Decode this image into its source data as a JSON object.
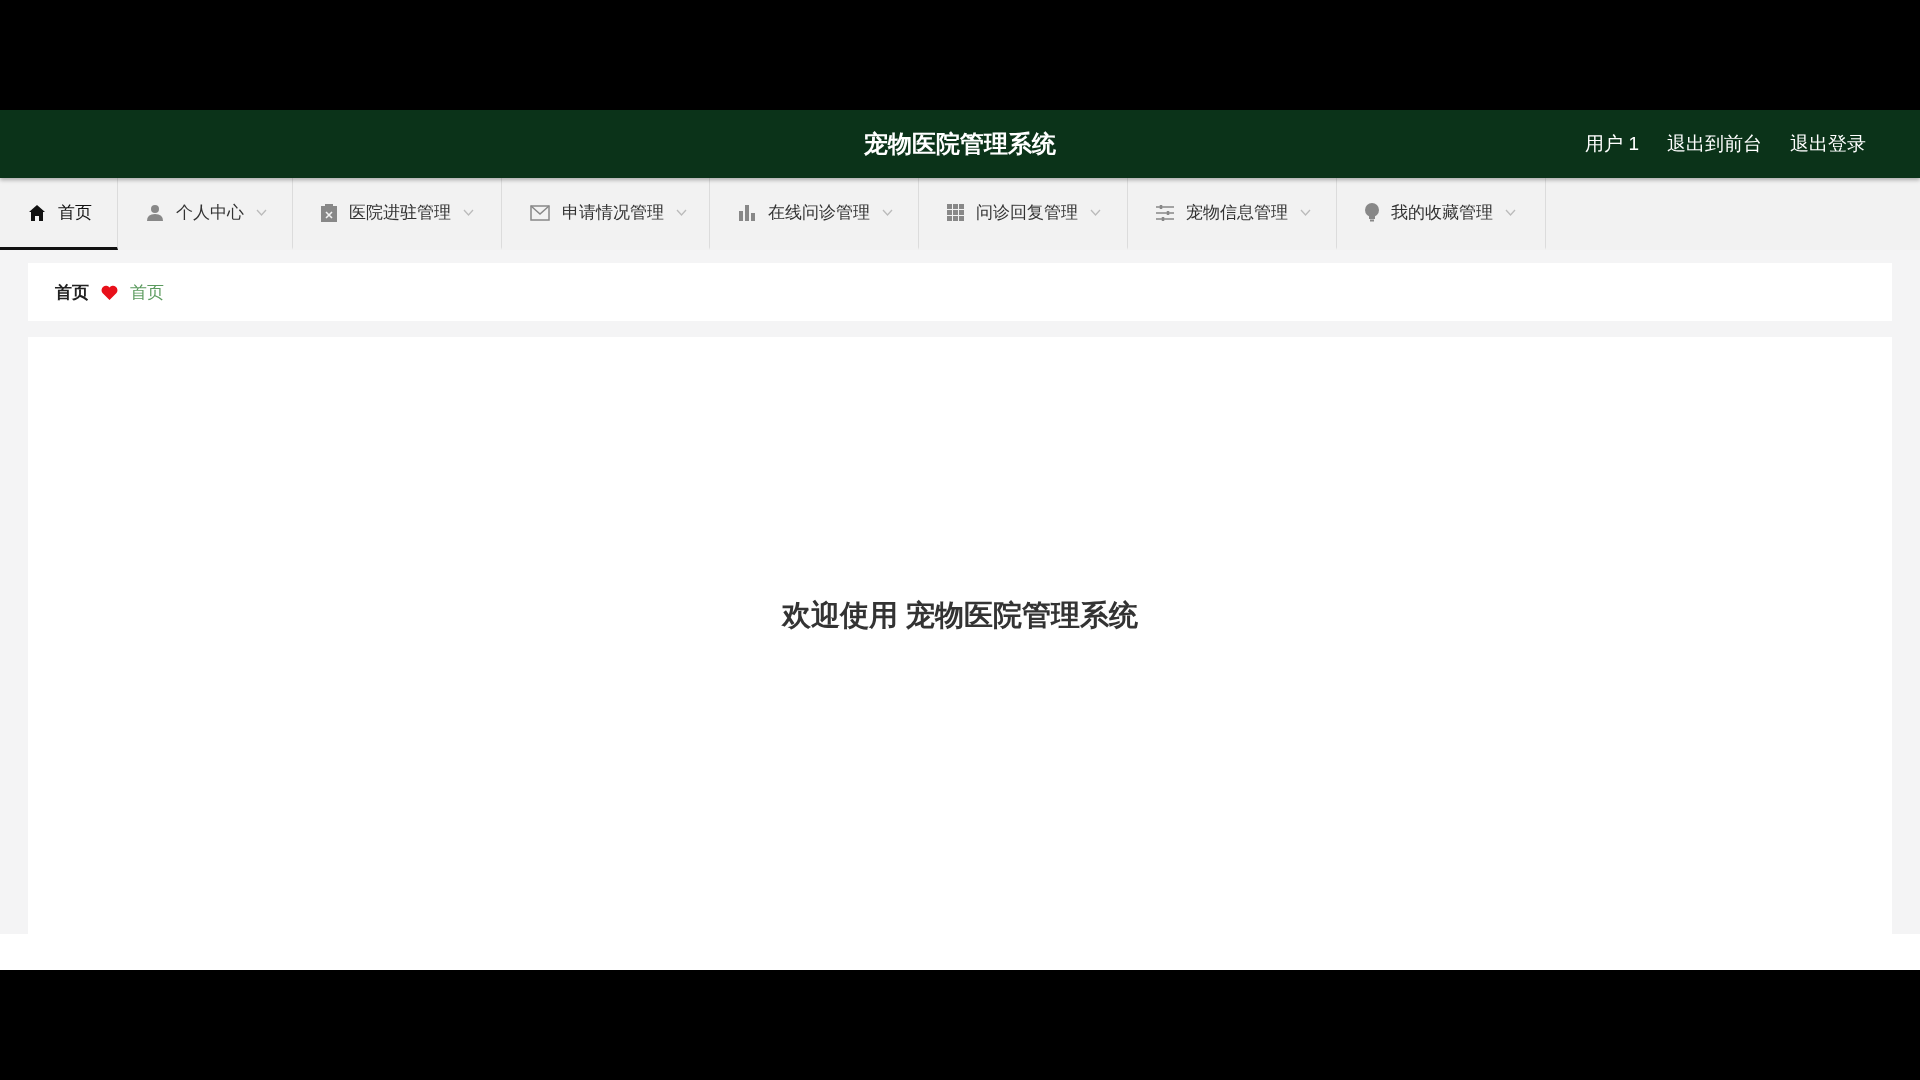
{
  "header": {
    "title": "宠物医院管理系统",
    "links": [
      "用户 1",
      "退出到前台",
      "退出登录"
    ]
  },
  "nav": [
    {
      "label": "首页",
      "kind": "link",
      "selected": true
    },
    {
      "label": "个人中心",
      "kind": "menu",
      "selected": false
    },
    {
      "label": "医院进驻管理",
      "kind": "menu",
      "selected": false
    },
    {
      "label": "申请情况管理",
      "kind": "menu",
      "selected": false
    },
    {
      "label": "在线问诊管理",
      "kind": "menu",
      "selected": false
    },
    {
      "label": "问诊回复管理",
      "kind": "menu",
      "selected": false
    },
    {
      "label": "宠物信息管理",
      "kind": "menu",
      "selected": false
    },
    {
      "label": "我的收藏管理",
      "kind": "menu",
      "selected": false
    }
  ],
  "breadcrumb": {
    "root": "首页",
    "current": "首页"
  },
  "welcome": "欢迎使用 宠物医院管理系统"
}
